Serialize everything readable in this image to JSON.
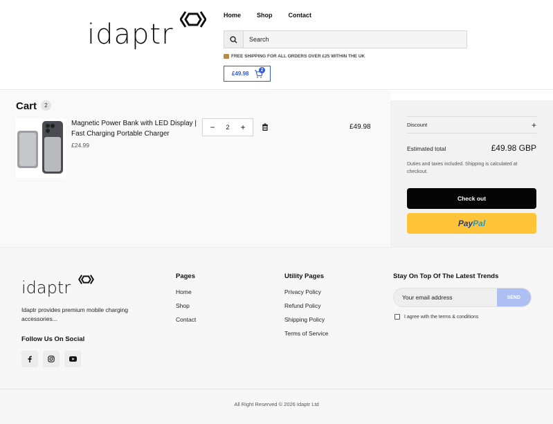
{
  "header": {
    "logo_text": "idaptr",
    "nav": [
      "Home",
      "Shop",
      "Contact"
    ],
    "search_placeholder": "Search",
    "shipping_notice": "FREE SHIPPING FOR ALL ORDERS OVER £25 WITHIN THE UK",
    "cart_total": "£49.98",
    "cart_badge": "2"
  },
  "cart": {
    "title": "Cart",
    "count": "2",
    "item": {
      "name": "Magnetic Power Bank with LED Display | Fast Charging Portable Charger",
      "unit_price": "£24.99",
      "quantity": "2",
      "line_total": "£49.98"
    }
  },
  "summary": {
    "discount_label": "Discount",
    "estimated_label": "Estimated total",
    "estimated_value": "£49.98 GBP",
    "duties_note": "Duties and taxes included. Shipping is calculated at checkout.",
    "checkout_label": "Check out",
    "paypal_part1": "Pay",
    "paypal_part2": "Pal"
  },
  "footer": {
    "logo_text": "idaptr",
    "description": "Idaptr provides premium mobile charging accessories...",
    "follow_title": "Follow Us On Social",
    "pages_title": "Pages",
    "pages_links": [
      "Home",
      "Shop",
      "Contact"
    ],
    "utility_title": "Utility Pages",
    "utility_links": [
      "Privacy Policy",
      "Refund Policy",
      "Shipping Policy",
      "Terms of Service"
    ],
    "newsletter_title": "Stay On Top Of The Latest Trends",
    "email_placeholder": "Your email address",
    "send_label": "SEND",
    "agree_label": "I agree with the terms & conditions",
    "copyright": "All Right Reserved © 2026 Idaptr Ltd"
  },
  "colors": {
    "accent_blue": "#2f5bd3",
    "checkout_black": "#050505",
    "paypal_yellow": "#ffc439",
    "send_button": "#aebff4"
  },
  "icons": [
    "search-icon",
    "cart-icon",
    "trash-icon",
    "minus-icon",
    "plus-icon",
    "facebook-icon",
    "instagram-icon",
    "youtube-icon",
    "shipping-box-icon"
  ]
}
